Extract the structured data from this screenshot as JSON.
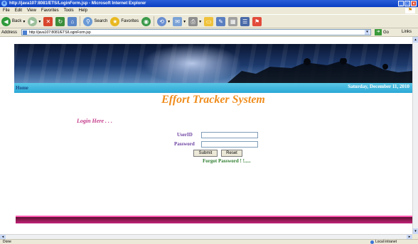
{
  "window": {
    "title": "http://java107:8081/ETS/LoginForm.jsp - Microsoft Internet Explorer",
    "buttons": [
      "_",
      "□",
      "×"
    ]
  },
  "menu": [
    "File",
    "Edit",
    "View",
    "Favorites",
    "Tools",
    "Help"
  ],
  "toolbar": {
    "back_label": "Back",
    "search_label": "Search",
    "favorites_label": "Favorites"
  },
  "address": {
    "label": "Address",
    "url": "http://java107:8081/ETS/LoginForm.jsp",
    "go_label": "Go",
    "links_label": "Links"
  },
  "page": {
    "nav_home": "Home",
    "date": "Saturday, December 11, 2010",
    "title": "Effort Tracker System",
    "login_heading": "Login Here . . .",
    "userid_label": "UserID",
    "password_label": "Password",
    "userid_value": "",
    "password_value": "",
    "submit_label": "Submit",
    "reset_label": "Reset",
    "forgot_label": "Forgot Password ! !....."
  },
  "statusbar": {
    "text": "Done",
    "zone": "Local intranet"
  },
  "colors": {
    "title_orange": "#f08c1c",
    "login_pink": "#c43a8a",
    "label_purple": "#6b3fa0",
    "forgot_green": "#2e7d2e",
    "banner_blue": "#2aa8d6",
    "footer_magenta": "#c2217a"
  }
}
